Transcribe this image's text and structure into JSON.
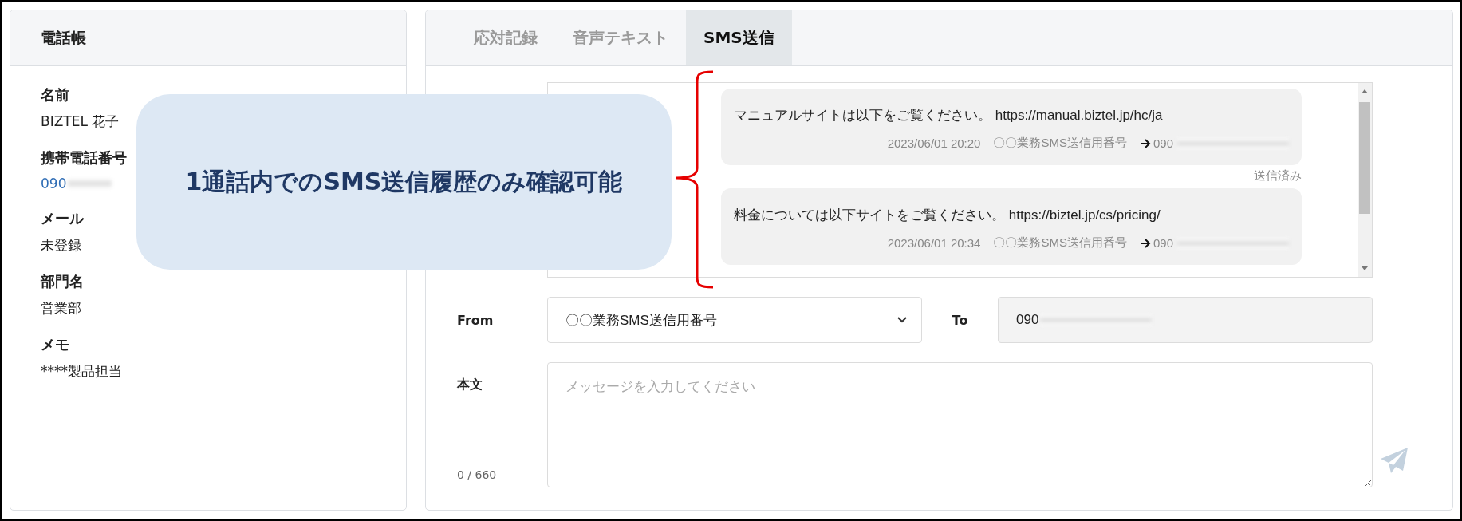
{
  "phonebook": {
    "title": "電話帳",
    "fields": [
      {
        "label": "名前",
        "value": "BIZTEL 花子",
        "kind": "text"
      },
      {
        "label": "携帯電話番号",
        "value": "090",
        "kind": "link",
        "redacted": true
      },
      {
        "label": "メール",
        "value": "未登録",
        "kind": "text"
      },
      {
        "label": "部門名",
        "value": "営業部",
        "kind": "text"
      },
      {
        "label": "メモ",
        "value": "****製品担当",
        "kind": "text"
      }
    ]
  },
  "tabs": [
    {
      "label": "応対記録",
      "selected": false
    },
    {
      "label": "音声テキスト",
      "selected": false
    },
    {
      "label": "SMS送信",
      "selected": true
    }
  ],
  "messages": [
    {
      "text": "マニュアルサイトは以下をご覧ください。 https://manual.biztel.jp/hc/ja",
      "date": "2023/06/01 20:20",
      "sender": "〇〇業務SMS送信用番号",
      "recipient": "090",
      "redacted": true,
      "status": "送信済み"
    },
    {
      "text": "料金については以下サイトをご覧ください。 https://biztel.jp/cs/pricing/",
      "date": "2023/06/01 20:34",
      "sender": "〇〇業務SMS送信用番号",
      "recipient": "090",
      "redacted": true
    }
  ],
  "form": {
    "from_label": "From",
    "from_value": "〇〇業務SMS送信用番号",
    "to_label": "To",
    "to_value": "090",
    "to_redacted": true,
    "body_label": "本文",
    "placeholder": "メッセージを入力してください",
    "counter": "0 / 660"
  },
  "callout": {
    "text": "1通話内でのSMS送信履歴のみ確認可能"
  }
}
